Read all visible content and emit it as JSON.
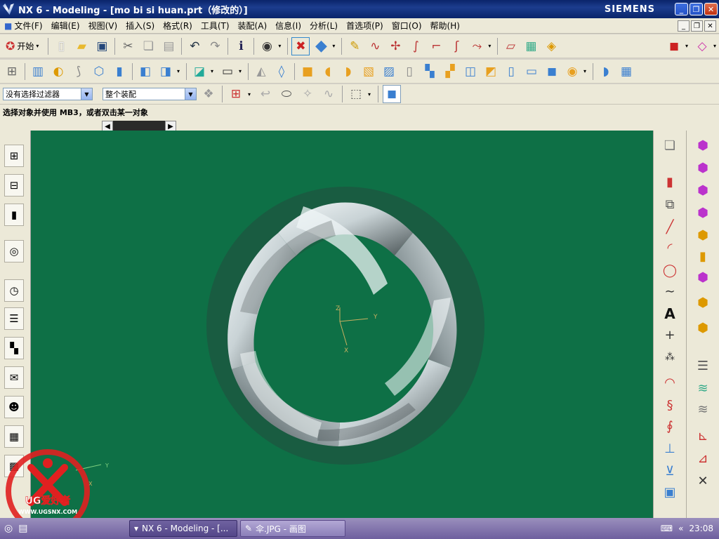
{
  "window": {
    "title": "NX 6 - Modeling - [mo bi si huan.prt（修改的）]",
    "brand": "SIEMENS",
    "controls": [
      "_",
      "❐",
      "✕"
    ]
  },
  "menu": {
    "items": [
      "文件(F)",
      "编辑(E)",
      "视图(V)",
      "插入(S)",
      "格式(R)",
      "工具(T)",
      "装配(A)",
      "信息(I)",
      "分析(L)",
      "首选项(P)",
      "窗口(O)",
      "帮助(H)"
    ]
  },
  "toolbar1": {
    "start_label": "开始"
  },
  "filter": {
    "type_value": "没有选择过滤器",
    "scope_value": "整个装配"
  },
  "cue": {
    "text": "选择对象并使用 MB3，或者双击某一对象"
  },
  "viewport": {
    "background": "#0e7046",
    "wcs_labels": {
      "x": "X",
      "y": "Y",
      "z": "Z"
    },
    "abs_labels": {
      "x": "X",
      "y": "Y"
    }
  },
  "watermark": {
    "text1": "UG爱好者",
    "text2": "WWW.UGSNX.COM"
  },
  "taskbar": {
    "tasks": [
      "NX 6 - Modeling - [...",
      "伞.JPG - 画图"
    ],
    "clock": "23:08"
  },
  "colors": {
    "accent": "#0a246a",
    "viewport_bg": "#0e7046",
    "taskbar": "#7a6ba8"
  }
}
